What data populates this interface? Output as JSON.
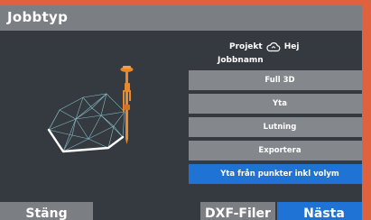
{
  "dialog": {
    "title": "Jobbtyp",
    "project_label": "Projekt",
    "project_name": "Hej",
    "job_name_label": "Jobbnamn"
  },
  "icons": {
    "cloud": "cloud-sync-icon",
    "illustration": "surface-survey-illustration"
  },
  "options": [
    {
      "label": "Full 3D",
      "selected": false
    },
    {
      "label": "Yta",
      "selected": false
    },
    {
      "label": "Lutning",
      "selected": false
    },
    {
      "label": "Exportera",
      "selected": false
    },
    {
      "label": "Yta från punkter inkl volym",
      "selected": true
    }
  ],
  "footer": {
    "close_label": "Stäng",
    "dxf_label": "DXF-Filer",
    "next_label": "Nästa"
  },
  "colors": {
    "accent": "#1f73d4",
    "brand": "#e0613e",
    "panel": "#343a40",
    "button": "#84888c"
  }
}
